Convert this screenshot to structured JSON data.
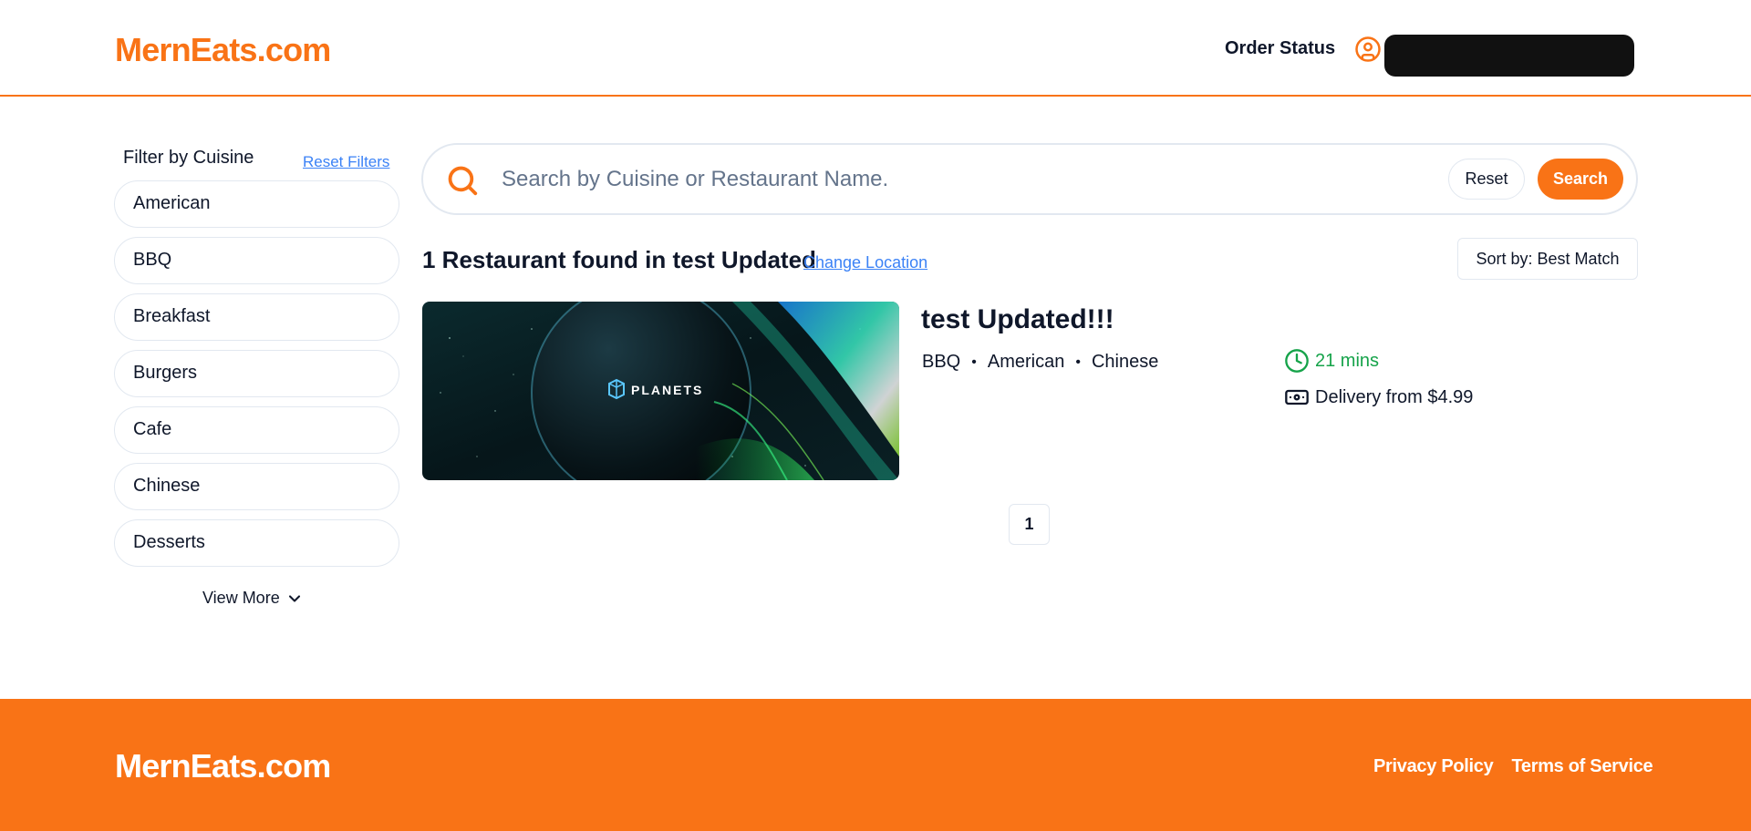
{
  "header": {
    "logo": "MernEats.com",
    "order_status": "Order Status",
    "username": ""
  },
  "sidebar": {
    "title": "Filter by Cuisine",
    "reset_filters": "Reset Filters",
    "cuisines": [
      "American",
      "BBQ",
      "Breakfast",
      "Burgers",
      "Cafe",
      "Chinese",
      "Desserts"
    ],
    "view_more": "View More"
  },
  "search": {
    "placeholder": "Search by Cuisine or Restaurant Name.",
    "reset_label": "Reset",
    "search_label": "Search"
  },
  "results": {
    "title": "1 Restaurant found in test Updated",
    "change_location": "Change Location",
    "sort_label": "Sort by: Best Match"
  },
  "restaurant": {
    "name": "test Updated!!!",
    "cuisines": [
      "BBQ",
      "American",
      "Chinese"
    ],
    "delivery_time": "21 mins",
    "delivery_price": "Delivery from $4.99",
    "image_logo_text": "PLANETS"
  },
  "pagination": {
    "current_page": "1"
  },
  "footer": {
    "logo": "MernEats.com",
    "privacy_policy": "Privacy Policy",
    "terms_of_service": "Terms of Service"
  },
  "colors": {
    "brand": "#f97316",
    "link": "#3b82f6",
    "success": "#16a34a",
    "border": "#e2e8f0"
  },
  "icons": [
    "user-circle-icon",
    "search-icon",
    "chevron-down-icon",
    "clock-icon",
    "banknote-icon"
  ]
}
